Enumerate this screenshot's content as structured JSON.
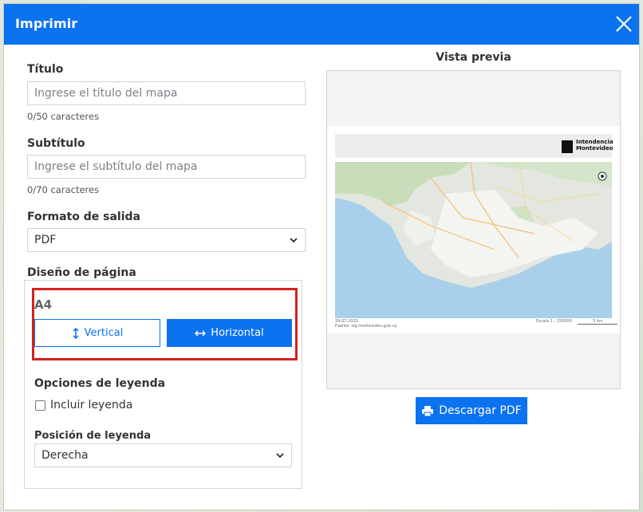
{
  "dialog": {
    "title": "Imprimir"
  },
  "form": {
    "title_label": "Título",
    "title_placeholder": "Ingrese el título del mapa",
    "title_counter": "0/50 caracteres",
    "subtitle_label": "Subtítulo",
    "subtitle_placeholder": "Ingrese el subtítulo del mapa",
    "subtitle_counter": "0/70 caracteres",
    "format_label": "Formato de salida",
    "format_value": "PDF",
    "layout_label": "Diseño de página",
    "page_size": "A4",
    "vertical_label": "Vertical",
    "horizontal_label": "Horizontal",
    "legend_options_label": "Opciones de leyenda",
    "include_legend_label": "Incluir leyenda",
    "legend_position_label": "Posición de leyenda",
    "legend_position_value": "Derecha"
  },
  "preview": {
    "title": "Vista previa",
    "logo_line1": "Intendencia",
    "logo_line2": "Montevideo",
    "footer_date": "29.07.2020",
    "footer_source": "Fuente: sig.montevideo.gub.uy",
    "scale_label": "Escala 1 : 150000",
    "scale_bar_label": "5 km"
  },
  "download_button": "Descargar PDF",
  "colors": {
    "primary": "#0b72f0",
    "highlight_border": "#d62020"
  },
  "icons": {
    "close": "close-icon",
    "vertical": "vertical-arrows-icon",
    "horizontal": "horizontal-arrows-icon",
    "chevron": "chevron-down-icon",
    "printer": "printer-icon"
  }
}
